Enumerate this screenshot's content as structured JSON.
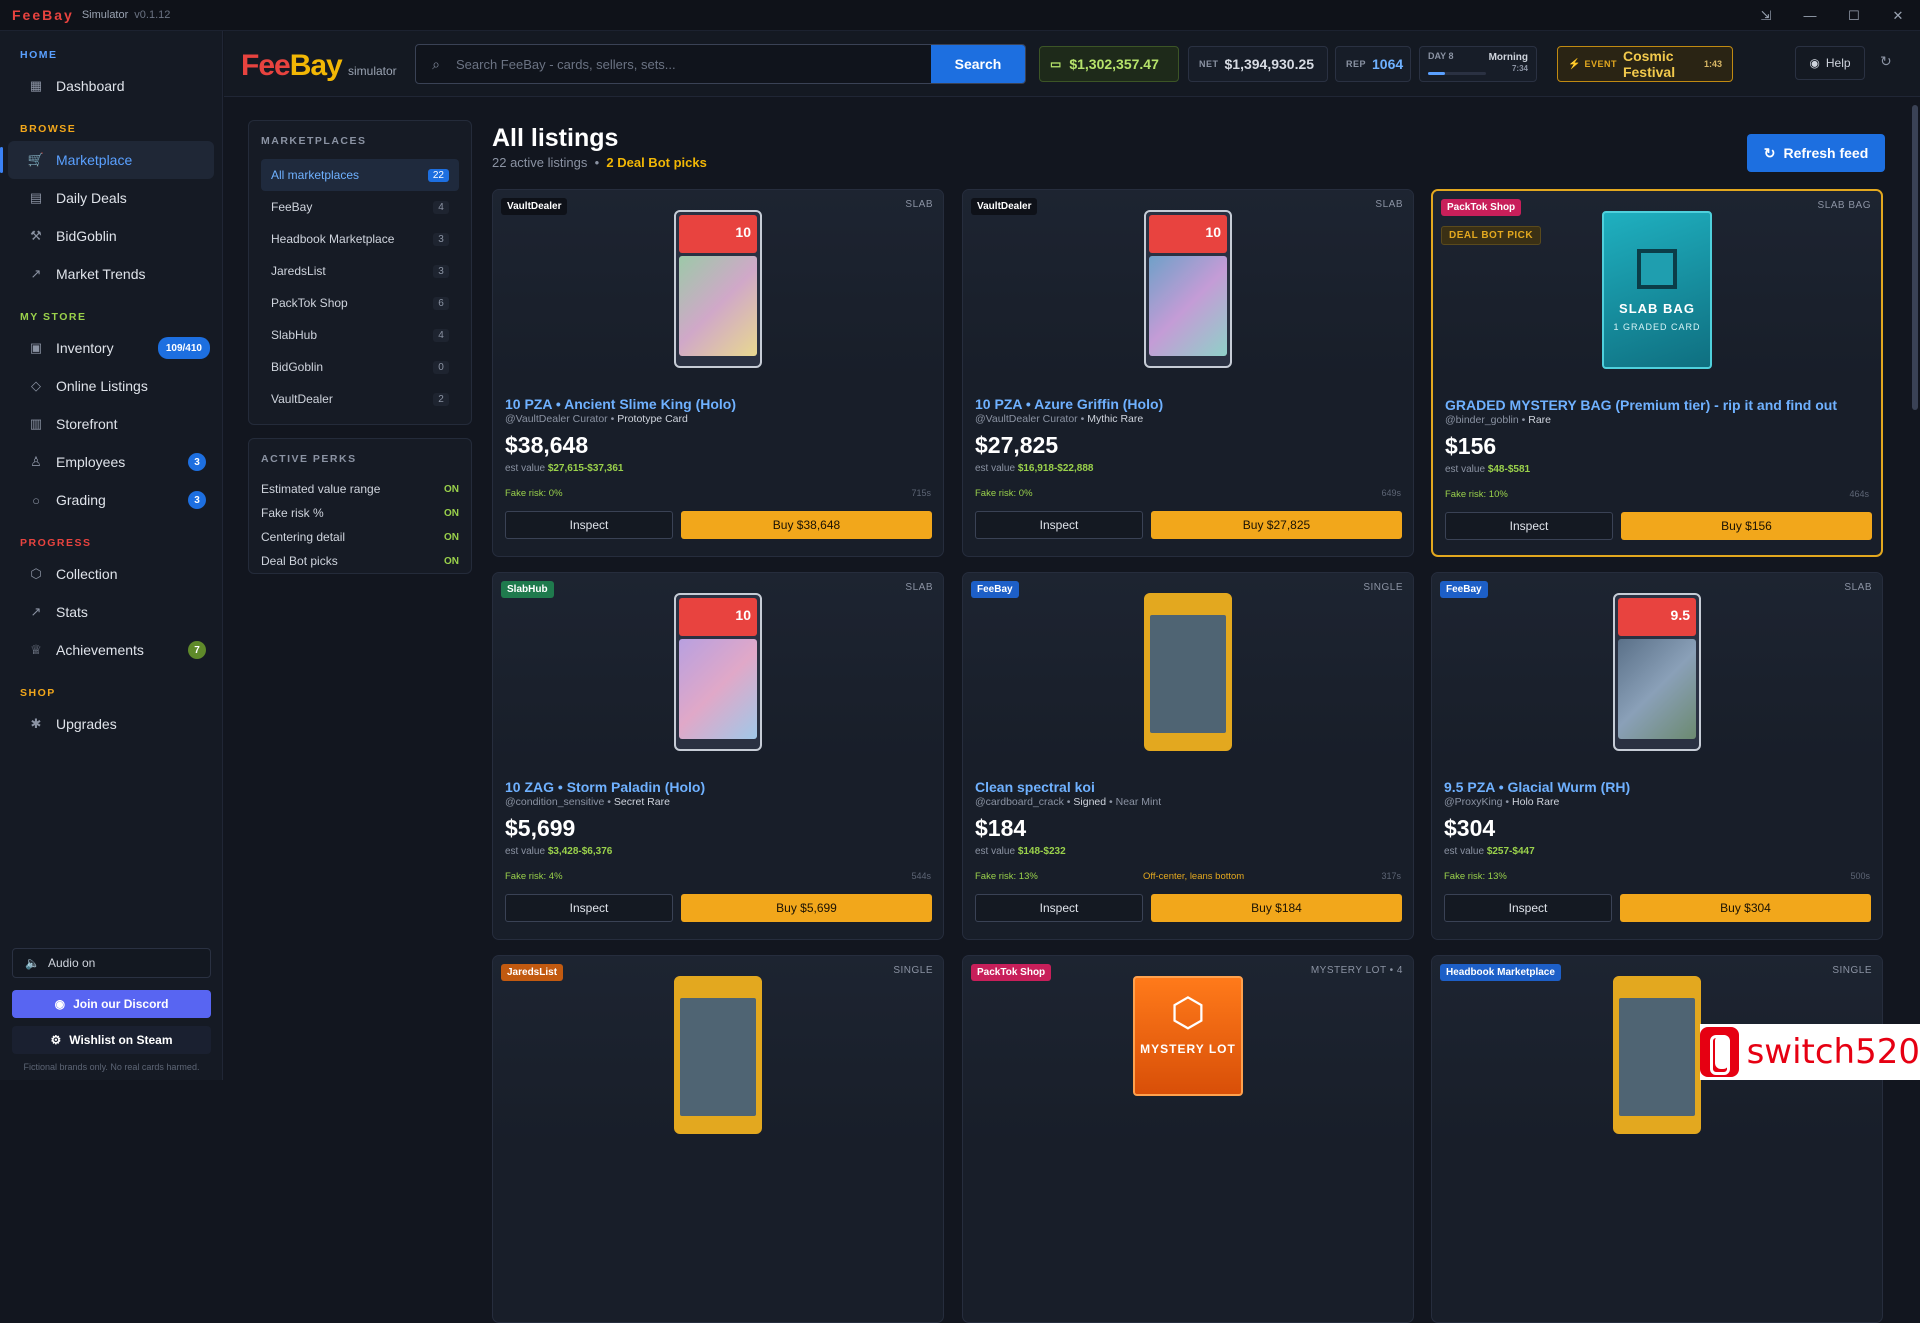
{
  "titlebar": {
    "logo": "FeeBay",
    "name": "Simulator",
    "version": "v0.1.12"
  },
  "sidebar": {
    "sections": [
      {
        "label": "HOME",
        "color": "#5aa0ff",
        "items": [
          {
            "label": "Dashboard",
            "icon": "grid-icon"
          }
        ]
      },
      {
        "label": "BROWSE",
        "color": "#f2a71b",
        "items": [
          {
            "label": "Marketplace",
            "icon": "cart-icon",
            "active": true
          },
          {
            "label": "Daily Deals",
            "icon": "calendar-icon"
          },
          {
            "label": "BidGoblin",
            "icon": "gavel-icon"
          },
          {
            "label": "Market Trends",
            "icon": "trend-icon"
          }
        ]
      },
      {
        "label": "MY STORE",
        "color": "#9ad14b",
        "items": [
          {
            "label": "Inventory",
            "icon": "box-icon",
            "badge": "109/410"
          },
          {
            "label": "Online Listings",
            "icon": "tag-icon"
          },
          {
            "label": "Storefront",
            "icon": "store-icon"
          },
          {
            "label": "Employees",
            "icon": "users-icon",
            "badge": "3"
          },
          {
            "label": "Grading",
            "icon": "circle-icon",
            "badge": "3"
          }
        ]
      },
      {
        "label": "PROGRESS",
        "color": "#e8433f",
        "items": [
          {
            "label": "Collection",
            "icon": "cube-icon"
          },
          {
            "label": "Stats",
            "icon": "chart-icon"
          },
          {
            "label": "Achievements",
            "icon": "trophy-icon",
            "badge": "7"
          }
        ]
      },
      {
        "label": "SHOP",
        "color": "#f2a71b",
        "items": [
          {
            "label": "Upgrades",
            "icon": "gear-icon"
          }
        ]
      }
    ],
    "audio": "Audio on",
    "discord": "Join our Discord",
    "steam": "Wishlist on Steam",
    "disclaimer": "Fictional brands only. No real cards harmed."
  },
  "topbar": {
    "logo": "FeeBay",
    "logo_sub": "simulator",
    "search_placeholder": "Search FeeBay - cards, sellers, sets...",
    "search_btn": "Search",
    "money": "$1,302,357.47",
    "net_label": "NET",
    "net": "$1,394,930.25",
    "rep_label": "REP",
    "rep": "1064",
    "day": "DAY 8",
    "period": "Morning",
    "time": "7:34",
    "day_progress": 0.3,
    "event_label": "EVENT",
    "event": "Cosmic Festival",
    "event_time": "1:43",
    "help": "Help"
  },
  "marketplaces": {
    "header": "MARKETPLACES",
    "items": [
      {
        "label": "All marketplaces",
        "count": "22",
        "active": true
      },
      {
        "label": "FeeBay",
        "count": "4"
      },
      {
        "label": "Headbook Marketplace",
        "count": "3"
      },
      {
        "label": "JaredsList",
        "count": "3"
      },
      {
        "label": "PackTok Shop",
        "count": "6"
      },
      {
        "label": "SlabHub",
        "count": "4"
      },
      {
        "label": "BidGoblin",
        "count": "0"
      },
      {
        "label": "VaultDealer",
        "count": "2"
      }
    ]
  },
  "perks": {
    "header": "ACTIVE PERKS",
    "items": [
      {
        "label": "Estimated value range",
        "state": "ON"
      },
      {
        "label": "Fake risk %",
        "state": "ON"
      },
      {
        "label": "Centering detail",
        "state": "ON"
      },
      {
        "label": "Deal Bot picks",
        "state": "ON"
      }
    ]
  },
  "main": {
    "title": "All listings",
    "active_count": "22 active listings",
    "deal_picks": "2 Deal Bot picks",
    "refresh": "Refresh feed"
  },
  "listings": [
    {
      "source": "VaultDealer",
      "src_class": "t-dark",
      "type": "SLAB",
      "kind": "slab",
      "title": "10 PZA • Ancient Slime King (Holo)",
      "seller": "@VaultDealer Curator",
      "rarity": "Prototype Card",
      "price": "$38,648",
      "est": "$27,615-$37,361",
      "risk": "Fake risk: 0%",
      "note": "",
      "age": "715s",
      "buy": "Buy $38,648",
      "grade": "10",
      "art": "linear-gradient(135deg,#9cc9a8,#d0a8c8,#e8d890)"
    },
    {
      "source": "VaultDealer",
      "src_class": "t-dark",
      "type": "SLAB",
      "kind": "slab",
      "title": "10 PZA • Azure Griffin (Holo)",
      "seller": "@VaultDealer Curator",
      "rarity": "Mythic Rare",
      "price": "$27,825",
      "est": "$16,918-$22,888",
      "risk": "Fake risk: 0%",
      "note": "",
      "age": "649s",
      "buy": "Buy $27,825",
      "grade": "10",
      "art": "linear-gradient(135deg,#6fa0c8,#c49cd6,#8fd0c8)"
    },
    {
      "source": "PackTok Shop",
      "src_class": "t-pink",
      "type": "SLAB BAG",
      "kind": "bag",
      "dbpick": "DEAL BOT PICK",
      "title": "GRADED MYSTERY BAG (Premium tier) - rip it and find out",
      "seller": "@binder_goblin",
      "rarity": "Rare",
      "price": "$156",
      "est": "$48-$581",
      "risk": "Fake risk: 10%",
      "note": "",
      "age": "464s",
      "buy": "Buy $156",
      "bag_title": "SLAB BAG",
      "bag_sub": "1 GRADED CARD"
    },
    {
      "source": "SlabHub",
      "src_class": "t-green",
      "type": "SLAB",
      "kind": "slab",
      "title": "10 ZAG • Storm Paladin (Holo)",
      "seller": "@condition_sensitive",
      "rarity": "Secret Rare",
      "price": "$5,699",
      "est": "$3,428-$6,376",
      "risk": "Fake risk: 4%",
      "note": "",
      "age": "544s",
      "buy": "Buy $5,699",
      "grade": "10",
      "art": "linear-gradient(135deg,#b8a0e0,#e0a8c8,#a0c8e8)"
    },
    {
      "source": "FeeBay",
      "src_class": "t-blue",
      "type": "SINGLE",
      "kind": "single",
      "title": "Clean spectral koi",
      "seller": "@cardboard_crack",
      "rarity": "Signed",
      "rarity2": "Near Mint",
      "price": "$184",
      "est": "$148-$232",
      "risk": "Fake risk: 13%",
      "note": "Off-center, leans bottom",
      "age": "317s",
      "buy": "Buy $184",
      "frame": "#e3a81f"
    },
    {
      "source": "FeeBay",
      "src_class": "t-blue",
      "type": "SLAB",
      "kind": "slab",
      "title": "9.5 PZA • Glacial Wurm (RH)",
      "seller": "@ProxyKing",
      "rarity": "Holo Rare",
      "price": "$304",
      "est": "$257-$447",
      "risk": "Fake risk: 13%",
      "note": "",
      "age": "500s",
      "buy": "Buy $304",
      "grade": "9.5",
      "art": "linear-gradient(135deg,#5a7088,#8aa0b8,#6c8a70)"
    },
    {
      "source": "JaredsList",
      "src_class": "t-orange",
      "type": "SINGLE",
      "kind": "single",
      "title": "",
      "price": "",
      "frame": "#e3a81f"
    },
    {
      "source": "PackTok Shop",
      "src_class": "t-pink",
      "type": "MYSTERY LOT • 4",
      "kind": "lot",
      "lot_title": "MYSTERY LOT"
    },
    {
      "source": "Headbook Marketplace",
      "src_class": "t-blue",
      "type": "SINGLE",
      "kind": "single",
      "title": "",
      "price": "",
      "frame": "#e3a81f"
    }
  ],
  "watermark": "switch520"
}
